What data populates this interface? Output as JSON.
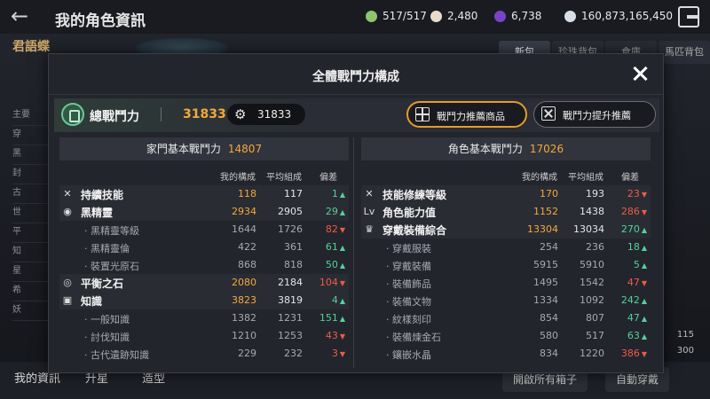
{
  "header": {
    "back_icon": "arrow-left-icon",
    "title": "我的角色資訊",
    "resources": [
      {
        "icon": "leaf-icon",
        "color": "#8fc46d",
        "value": "517/517"
      },
      {
        "icon": "pearl-icon",
        "color": "#e9dccc",
        "value": "2,480"
      },
      {
        "icon": "purple-gem-icon",
        "color": "#7b42c9",
        "value": "6,738"
      },
      {
        "icon": "silver-coin-icon",
        "color": "#d8dfe7",
        "value": "160,873,165,450"
      }
    ]
  },
  "background": {
    "char_name": "君語蝶",
    "side_items": [
      "主要",
      "穿",
      "黑",
      "封",
      "古",
      "世",
      "平",
      "知",
      "星",
      "希",
      "妖"
    ],
    "tabs": [
      "新包",
      "珍珠背包",
      "倉庫",
      "馬匹背包"
    ],
    "bottom_tabs": [
      "我的資訊",
      "升星",
      "造型"
    ],
    "bottom_btn_open": "開啟所有箱子",
    "bottom_btn_auto": "自動穿戴",
    "side_numbers": [
      "115",
      "300"
    ]
  },
  "modal": {
    "title": "全體戰鬥力構成",
    "total_label": "總戰鬥力",
    "total_value": "31833",
    "pill_value": "31833",
    "btn_recommend": "戰鬥力推薦商品",
    "btn_boost": "戰鬥力提升推薦",
    "col_my": "我的構成",
    "col_avg": "平均組成",
    "col_dev": "偏差",
    "left": {
      "label": "家門基本戰鬥力",
      "value": "14807",
      "rows": [
        {
          "kind": "main",
          "icon": "crossed-swords-icon",
          "glyph": "✕",
          "label": "持續技能",
          "my": "118",
          "avg": "117",
          "dev": "1",
          "dir": "up"
        },
        {
          "kind": "main",
          "icon": "black-spirit-icon",
          "glyph": "◉",
          "label": "黑精靈",
          "my": "2934",
          "avg": "2905",
          "dev": "29",
          "dir": "up"
        },
        {
          "kind": "sub",
          "label": "· 黑精靈等級",
          "my": "1644",
          "avg": "1726",
          "dev": "82",
          "dir": "down"
        },
        {
          "kind": "sub",
          "label": "· 黑精靈倫",
          "my": "422",
          "avg": "361",
          "dev": "61",
          "dir": "up"
        },
        {
          "kind": "sub",
          "label": "· 裝置光原石",
          "my": "868",
          "avg": "818",
          "dev": "50",
          "dir": "up"
        },
        {
          "kind": "main",
          "icon": "balance-stone-icon",
          "glyph": "◎",
          "label": "平衡之石",
          "my": "2080",
          "avg": "2184",
          "dev": "104",
          "dir": "down"
        },
        {
          "kind": "main",
          "icon": "book-icon",
          "glyph": "▣",
          "label": "知識",
          "my": "3823",
          "avg": "3819",
          "dev": "4",
          "dir": "up"
        },
        {
          "kind": "sub",
          "label": "· 一般知識",
          "my": "1382",
          "avg": "1231",
          "dev": "151",
          "dir": "up"
        },
        {
          "kind": "sub",
          "label": "· 討伐知識",
          "my": "1210",
          "avg": "1253",
          "dev": "43",
          "dir": "down"
        },
        {
          "kind": "sub",
          "label": "· 古代遺跡知識",
          "my": "229",
          "avg": "232",
          "dev": "3",
          "dir": "down"
        }
      ]
    },
    "right": {
      "label": "角色基本戰鬥力",
      "value": "17026",
      "rows": [
        {
          "kind": "main",
          "icon": "crossed-swords-icon",
          "glyph": "✕",
          "label": "技能修練等級",
          "my": "170",
          "avg": "193",
          "dev": "23",
          "dir": "down"
        },
        {
          "kind": "main",
          "icon": "level-icon",
          "glyph": "Lv",
          "label": "角色能力值",
          "my": "1152",
          "avg": "1438",
          "dev": "286",
          "dir": "down"
        },
        {
          "kind": "main",
          "icon": "armor-icon",
          "glyph": "♛",
          "label": "穿戴裝備綜合",
          "my": "13304",
          "avg": "13034",
          "dev": "270",
          "dir": "up"
        },
        {
          "kind": "sub",
          "label": "· 穿戴服裝",
          "my": "254",
          "avg": "236",
          "dev": "18",
          "dir": "up"
        },
        {
          "kind": "sub",
          "label": "· 穿戴裝備",
          "my": "5915",
          "avg": "5910",
          "dev": "5",
          "dir": "up"
        },
        {
          "kind": "sub",
          "label": "· 裝備飾品",
          "my": "1495",
          "avg": "1542",
          "dev": "47",
          "dir": "down"
        },
        {
          "kind": "sub",
          "label": "· 裝備文物",
          "my": "1334",
          "avg": "1092",
          "dev": "242",
          "dir": "up"
        },
        {
          "kind": "sub",
          "label": "· 紋樣刻印",
          "my": "854",
          "avg": "807",
          "dev": "47",
          "dir": "up"
        },
        {
          "kind": "sub",
          "label": "· 裝備煉金石",
          "my": "580",
          "avg": "517",
          "dev": "63",
          "dir": "up"
        },
        {
          "kind": "sub",
          "label": "· 鑲嵌水晶",
          "my": "834",
          "avg": "1220",
          "dev": "386",
          "dir": "down"
        }
      ]
    }
  }
}
